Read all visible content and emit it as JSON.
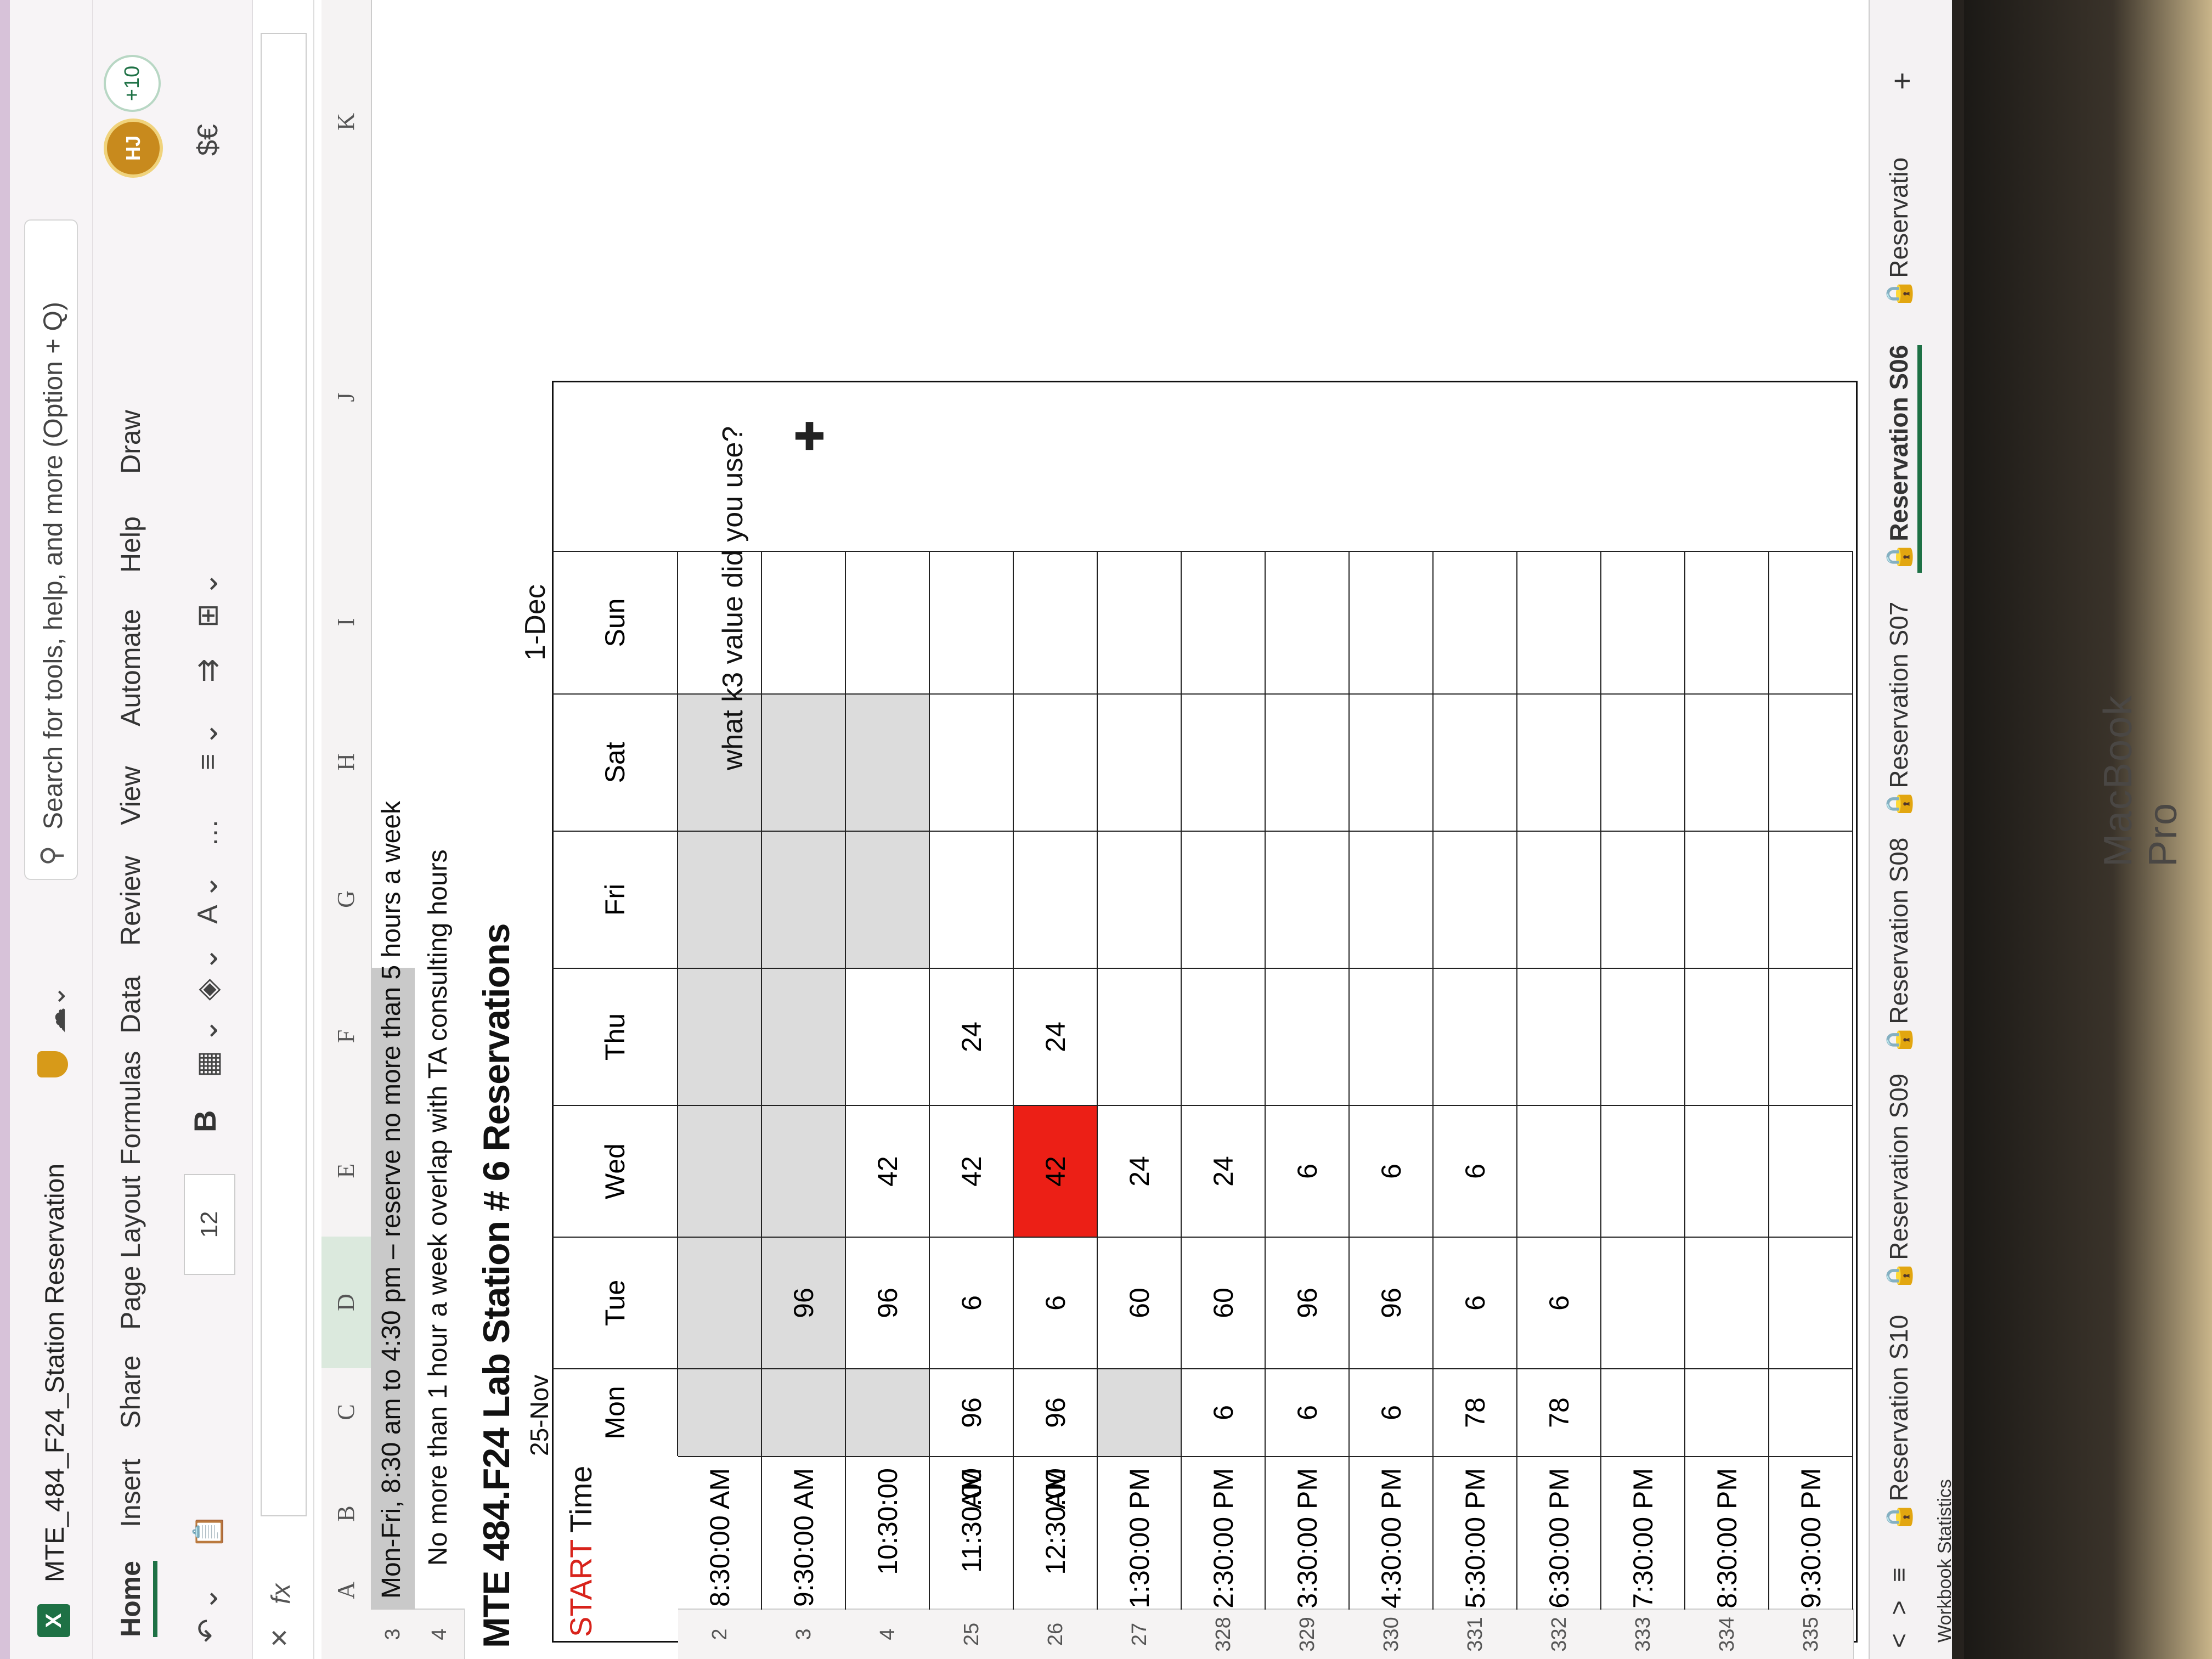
{
  "app": {
    "doc_title": "MTE_484_F24_Station Reservation",
    "search_placeholder": "Search for tools, help, and more (Option + Q)",
    "logo_letter": "X",
    "avatar_initials": "HJ",
    "more_badge": "+10",
    "laptop_brand": "MacBook Pro"
  },
  "ribbon": {
    "tabs": [
      "Home",
      "Insert",
      "Share",
      "Page Layout",
      "Formulas",
      "Data",
      "Review",
      "View",
      "Automate",
      "Help",
      "Draw"
    ],
    "active_tab": "Home",
    "font_size": "12",
    "bold_label": "B",
    "number_format": "$€"
  },
  "formula_bar": {
    "fx": "fx",
    "value": ""
  },
  "columns": [
    "A",
    "B",
    "C",
    "D",
    "E",
    "F",
    "G",
    "H",
    "I",
    "J",
    "K"
  ],
  "rows": {
    "r3": {
      "num": "3",
      "text": "Mon-Fri, 8:30 am to 4:30 pm – reserve no more than 5 hours a week"
    },
    "r4": {
      "num": "4",
      "text": "No more than 1 hour a week overlap with TA consulting hours"
    },
    "title": "MTE 484.F24 Lab Station # 6 Reservations",
    "date_start": "25-Nov",
    "date_end": "1-Dec",
    "note": "what k3 value did you use?"
  },
  "table": {
    "header_start": "START",
    "header_time": "Time",
    "days": [
      "Mon",
      "Tue",
      "Wed",
      "Thu",
      "Fri",
      "Sat",
      "Sun"
    ],
    "row_numbers": [
      "2",
      "3",
      "4",
      "25",
      "26",
      "27",
      "328",
      "329",
      "330",
      "331",
      "332",
      "333",
      "334",
      "335"
    ],
    "times": [
      "8:30:00 AM",
      "9:30:00 AM",
      "10:30:00 AM",
      "11:30:00 AM",
      "12:30:00 PM",
      "1:30:00 PM",
      "2:30:00 PM",
      "3:30:00 PM",
      "4:30:00 PM",
      "5:30:00 PM",
      "6:30:00 PM",
      "7:30:00 PM",
      "8:30:00 PM",
      "9:30:00 PM"
    ],
    "values": [
      [
        "",
        "",
        "",
        "",
        "",
        "",
        ""
      ],
      [
        "",
        "96",
        "",
        "",
        "",
        "",
        ""
      ],
      [
        "",
        "96",
        "42",
        "",
        "",
        "",
        ""
      ],
      [
        "96",
        "6",
        "42",
        "24",
        "",
        "",
        ""
      ],
      [
        "96",
        "6",
        "42",
        "24",
        "",
        "",
        ""
      ],
      [
        "",
        "60",
        "24",
        "",
        "",
        "",
        ""
      ],
      [
        "6",
        "60",
        "24",
        "",
        "",
        "",
        ""
      ],
      [
        "6",
        "96",
        "6",
        "",
        "",
        "",
        ""
      ],
      [
        "6",
        "96",
        "6",
        "",
        "",
        "",
        ""
      ],
      [
        "78",
        "6",
        "6",
        "",
        "",
        "",
        ""
      ],
      [
        "78",
        "6",
        "",
        "",
        "",
        "",
        ""
      ],
      [
        "",
        "",
        "",
        "",
        "",
        "",
        ""
      ],
      [
        "",
        "",
        "",
        "",
        "",
        "",
        ""
      ],
      [
        "",
        "",
        "",
        "",
        "",
        "",
        ""
      ]
    ],
    "highlight_color": "#ec1f16"
  },
  "sheets": {
    "tabs": [
      "Reservation S10",
      "Reservation S09",
      "Reservation S08",
      "Reservation S07",
      "Reservation S06",
      "Reservatio"
    ],
    "active": "Reservation S06",
    "add": "+",
    "menu": "≡",
    "prev": "<",
    "next": ">"
  },
  "status": {
    "text": "Workbook Statistics"
  }
}
